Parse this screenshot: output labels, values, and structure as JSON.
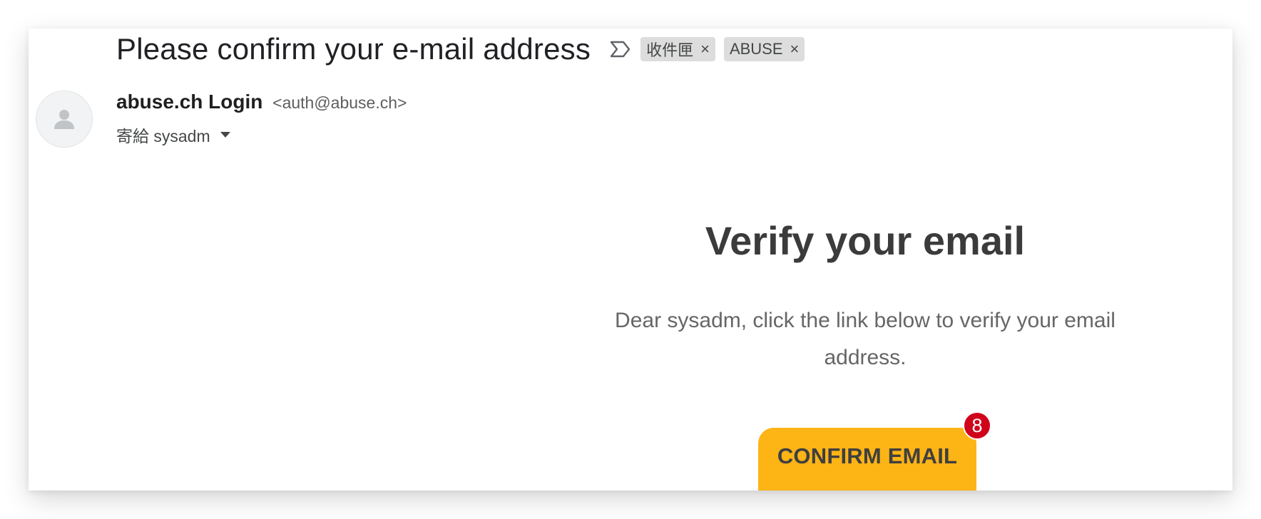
{
  "email": {
    "subject": "Please confirm your e-mail address",
    "labels": [
      {
        "name": "收件匣",
        "remove": "×"
      },
      {
        "name": "ABUSE",
        "remove": "×"
      }
    ],
    "sender": {
      "name": "abuse.ch Login",
      "address": "<auth@abuse.ch>"
    },
    "recipient": "寄給 sysadm"
  },
  "body": {
    "heading": "Verify your email",
    "message": "Dear sysadm, click the link below to verify your email address.",
    "button_label": "CONFIRM EMAIL",
    "badge_count": "8"
  },
  "colors": {
    "button": "#fdb415",
    "badge": "#d0021b",
    "chip": "#dddddd"
  }
}
